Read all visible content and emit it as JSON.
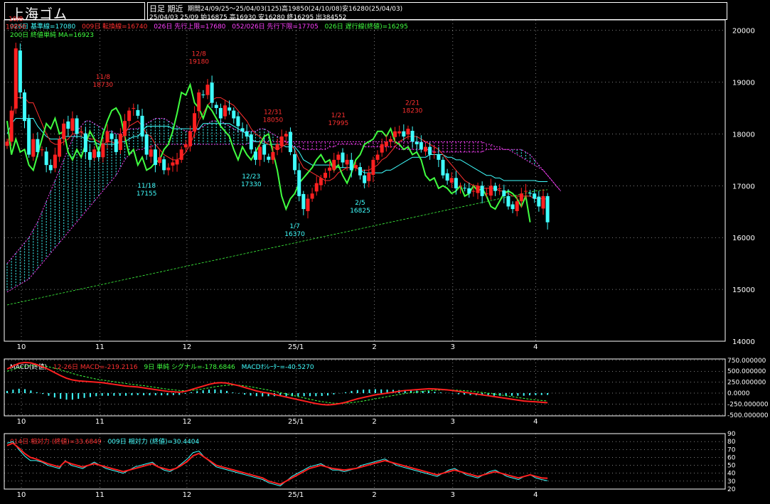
{
  "header": {
    "title": "上海ゴム",
    "mode": "日足 期近",
    "line1_stats": "期間24/09/25〜25/04/03(125)高19850(24/10/08)安16280(25/04/03)",
    "line2_stats": "25/04/03 25/09 始16875 高16930 安16280 終16295 出384552"
  },
  "legend_main": [
    {
      "text": "026日 基準線=17080",
      "color": "#40ffff"
    },
    {
      "text": "009日 転換線=16740",
      "color": "#ff3030"
    },
    {
      "text": "026日 先行上限=17680",
      "color": "#ff40ff"
    },
    {
      "text": "052/026日 先行下限=17705",
      "color": "#ff40ff"
    },
    {
      "text": "026日 遅行線(終値)=16295",
      "color": "#40ff40"
    }
  ],
  "legend_main2": [
    {
      "text": "200日 終値単純 MA=16923",
      "color": "#40ff40"
    }
  ],
  "legend_macd": [
    {
      "text": "MACD(終値)",
      "color": "#ffffff"
    },
    {
      "text": "12-26日 MACD=-219.2116",
      "color": "#ff3030"
    },
    {
      "text": "9日 単純 シグナル=-178.6846",
      "color": "#40ff40"
    },
    {
      "text": "MACDｵｼﾚｰﾀｰ=-40.5270",
      "color": "#40ffff"
    }
  ],
  "legend_rsi": [
    {
      "text": "014日 相対力 (終値)=33.6849",
      "color": "#ff3030"
    },
    {
      "text": "009日 相対力 (終値)=30.4404",
      "color": "#40ffff"
    }
  ],
  "x_labels": [
    "10",
    "11",
    "12",
    "25/1",
    "2",
    "3",
    "4"
  ],
  "colors": {
    "up": "#ff2020",
    "down": "#40ffff",
    "kijun": "#40ffff",
    "tenkan": "#ff3030",
    "senkou": "#ff40ff",
    "cloud_up": "#40ffff",
    "cloud_down": "#ff40ff",
    "chikou": "#40ff40",
    "ma": "#40ff40",
    "annot_hi": "#ff3030",
    "annot_lo": "#40ffff",
    "grid": "#ffffff",
    "macd": "#ff2020",
    "signal": "#40ff40",
    "osc": "#40ffff",
    "rsi14": "#ff2020",
    "rsi9": "#40ffff"
  },
  "chart_data": [
    {
      "type": "candlestick",
      "name": "price",
      "yticks": [
        20000,
        19000,
        18000,
        17000,
        16000,
        15000,
        14000
      ],
      "ylim": [
        14000,
        20200
      ],
      "annotations": [
        {
          "date": "10/8",
          "value": 19850,
          "kind": "high"
        },
        {
          "date": "11/8",
          "value": 18730,
          "kind": "high"
        },
        {
          "date": "11/18",
          "value": 17155,
          "kind": "low"
        },
        {
          "date": "12/8",
          "value": 19180,
          "kind": "high"
        },
        {
          "date": "12/23",
          "value": 17330,
          "kind": "low"
        },
        {
          "date": "12/31",
          "value": 18050,
          "kind": "high"
        },
        {
          "date": "1/7",
          "value": 16370,
          "kind": "low"
        },
        {
          "date": "1/21",
          "value": 17995,
          "kind": "high"
        },
        {
          "date": "2/5",
          "value": 16825,
          "kind": "low"
        },
        {
          "date": "2/21",
          "value": 18230,
          "kind": "high"
        }
      ],
      "close": [
        17850,
        18450,
        19650,
        18800,
        18250,
        17600,
        17900,
        17650,
        17700,
        17400,
        17300,
        17600,
        17900,
        18200,
        18100,
        18300,
        18000,
        18050,
        17650,
        17500,
        17700,
        17550,
        17800,
        18050,
        17900,
        17650,
        18000,
        18250,
        18450,
        18500,
        18350,
        17950,
        17600,
        17700,
        17400,
        17550,
        17300,
        17350,
        17450,
        17500,
        17700,
        17800,
        18050,
        18400,
        18800,
        18750,
        18950,
        18600,
        18500,
        18300,
        18550,
        18450,
        18300,
        18150,
        18050,
        17950,
        17700,
        17500,
        17750,
        17600,
        17500,
        17650,
        17800,
        17950,
        18000,
        17650,
        17300,
        16800,
        16550,
        16750,
        16850,
        17050,
        17150,
        17250,
        17350,
        17500,
        17600,
        17450,
        17500,
        17300,
        17400,
        17200,
        17050,
        17250,
        17500,
        17600,
        17800,
        17850,
        17900,
        18050,
        18050,
        17950,
        18100,
        17850,
        17800,
        17700,
        17750,
        17600,
        17650,
        17500,
        17200,
        17100,
        17150,
        16950,
        17000,
        16950,
        16850,
        16900,
        17000,
        16800,
        16850,
        17000,
        16900,
        16950,
        16800,
        16600,
        16550,
        16700,
        16850,
        16900,
        16850,
        16750,
        16600,
        16800,
        16295
      ],
      "kijun": [
        18000,
        18200,
        18300,
        18300,
        18300,
        18300,
        18300,
        18150,
        18050,
        17950,
        17900,
        17900,
        17900,
        17950,
        17950,
        17950,
        17950,
        17950,
        17900,
        17850,
        17850,
        17800,
        17800,
        17800,
        17800,
        17800,
        17850,
        17850,
        17900,
        17950,
        17950,
        18050,
        18150,
        18150,
        18150,
        18150,
        18150,
        18150,
        18100,
        18100,
        18100,
        18100,
        18100,
        18100,
        18100,
        18200,
        18200,
        18200,
        18200,
        18200,
        18200,
        18200,
        18150,
        18100,
        18050,
        18000,
        17900,
        17850,
        17850,
        17800,
        17800,
        17800,
        17800,
        17800,
        17750,
        17750,
        17750,
        17650,
        17500,
        17450,
        17400,
        17400,
        17400,
        17400,
        17400,
        17400,
        17350,
        17350,
        17350,
        17350,
        17350,
        17300,
        17250,
        17250,
        17250,
        17250,
        17250,
        17300,
        17300,
        17350,
        17400,
        17450,
        17500,
        17550,
        17550,
        17550,
        17550,
        17600,
        17600,
        17600,
        17600,
        17550,
        17550,
        17500,
        17500,
        17450,
        17400,
        17350,
        17300,
        17250,
        17200,
        17200,
        17150,
        17150,
        17100,
        17100,
        17100,
        17100,
        17100,
        17100,
        17100,
        17100,
        17080,
        17080,
        17080
      ],
      "tenkan": [
        17800,
        18100,
        18700,
        18700,
        18700,
        18600,
        18600,
        18400,
        18200,
        18000,
        17850,
        17800,
        17800,
        17850,
        17900,
        18000,
        18000,
        18050,
        17950,
        17900,
        17900,
        17850,
        17800,
        17850,
        17850,
        17800,
        17900,
        18000,
        18150,
        18200,
        18250,
        18150,
        18000,
        17950,
        17800,
        17700,
        17600,
        17550,
        17500,
        17500,
        17550,
        17650,
        17800,
        18000,
        18250,
        18400,
        18550,
        18650,
        18700,
        18700,
        18650,
        18600,
        18550,
        18450,
        18350,
        18250,
        18100,
        18000,
        17950,
        17850,
        17800,
        17750,
        17700,
        17750,
        17800,
        17800,
        17700,
        17500,
        17350,
        17300,
        17250,
        17200,
        17150,
        17100,
        17100,
        17150,
        17250,
        17300,
        17350,
        17350,
        17350,
        17300,
        17300,
        17300,
        17350,
        17400,
        17500,
        17550,
        17650,
        17750,
        17850,
        17900,
        17950,
        17950,
        17950,
        17900,
        17850,
        17800,
        17750,
        17700,
        17600,
        17500,
        17400,
        17300,
        17200,
        17100,
        17050,
        17000,
        17000,
        16950,
        16950,
        16950,
        16950,
        16900,
        16900,
        16850,
        16800,
        16800,
        16800,
        16800,
        16800,
        16750,
        16750,
        16750,
        16740
      ],
      "senkou_a": [
        15500,
        15600,
        15700,
        15800,
        15900,
        16000,
        16150,
        16300,
        16500,
        16700,
        16900,
        17100,
        17300,
        17500,
        17700,
        17900,
        18050,
        18150,
        18250,
        18250,
        18200,
        18150,
        18100,
        18050,
        18050,
        18000,
        18000,
        18050,
        18100,
        18100,
        18100,
        18150,
        18200,
        18250,
        18300,
        18300,
        18300,
        18250,
        18200,
        18150,
        18100,
        18050,
        18050,
        18050,
        18100,
        18150,
        18200,
        18250,
        18250,
        18250,
        18200,
        18150,
        18100,
        18050,
        18050,
        18050,
        18050,
        18050,
        18100,
        18100,
        18050,
        18000,
        17950,
        17900,
        17850,
        17800,
        17750,
        17750,
        17700,
        17700,
        17700,
        17700,
        17700,
        17700,
        17750,
        17750,
        17800,
        17800,
        17800,
        17800,
        17800,
        17800,
        17750,
        17750,
        17750,
        17750,
        17750,
        17750,
        17750,
        17750,
        17700,
        17700,
        17700,
        17700,
        17700,
        17700,
        17700,
        17700,
        17650,
        17650,
        17650,
        17650,
        17650,
        17650,
        17650,
        17650,
        17650,
        17650,
        17650,
        17650,
        17700,
        17700,
        17700,
        17700,
        17700,
        17700,
        17700,
        17700,
        17700,
        17650,
        17600,
        17500,
        17400,
        17300,
        17200,
        17100,
        17000,
        16900
      ],
      "senkou_b": [
        14950,
        15000,
        15050,
        15100,
        15150,
        15200,
        15300,
        15400,
        15500,
        15600,
        15700,
        15800,
        15900,
        16000,
        16100,
        16200,
        16300,
        16400,
        16500,
        16600,
        16700,
        16800,
        16900,
        17000,
        17100,
        17200,
        17350,
        17500,
        17600,
        17650,
        17700,
        17700,
        17750,
        17750,
        17800,
        17800,
        17800,
        17800,
        17800,
        17800,
        17800,
        17800,
        17800,
        17800,
        17800,
        17800,
        17800,
        17800,
        17800,
        17800,
        17800,
        17800,
        17800,
        17800,
        17800,
        17800,
        17850,
        17850,
        17850,
        17850,
        17850,
        17850,
        17850,
        17850,
        17850,
        17850,
        17850,
        17850,
        17850,
        17850,
        17850,
        17850,
        17850,
        17850,
        17850,
        17850,
        17850,
        17850,
        17850,
        17850,
        17850,
        17850,
        17850,
        17850,
        17850,
        17850,
        17850,
        17850,
        17850,
        17850,
        17850,
        17850,
        17850,
        17850,
        17850,
        17850,
        17850,
        17850,
        17850,
        17850,
        17850,
        17850,
        17850,
        17850,
        17850,
        17850,
        17850,
        17850,
        17850,
        17850,
        17800,
        17800,
        17750,
        17750,
        17700,
        17700,
        17650,
        17600,
        17550,
        17500,
        17450,
        17400,
        17350,
        17300,
        17200,
        17100,
        17000,
        16900
      ],
      "ma200": [
        14700,
        14750,
        14800,
        14850,
        14900,
        14950,
        15000,
        15050,
        15100,
        15150,
        15200,
        15250,
        15300,
        15350,
        15400,
        15450,
        15500,
        15550,
        15600,
        15650,
        15700,
        15750,
        15800,
        15850,
        15900,
        15950,
        16000,
        16050,
        16100,
        16150,
        16200,
        16250,
        16300,
        16350,
        16400,
        16450,
        16500,
        16550,
        16600,
        16650,
        16700,
        16750,
        16800,
        16850,
        16900,
        16923
      ]
    },
    {
      "type": "macd",
      "yticks": [
        750,
        500,
        250,
        0,
        -250,
        -500
      ],
      "ytick_labels": [
        "750.000000",
        "500.000000",
        "250.000000",
        "0.0000",
        "-250.000000",
        "-500.000000"
      ],
      "ylim": [
        -520,
        780
      ],
      "macd": [
        550,
        620,
        680,
        700,
        690,
        650,
        600,
        540,
        470,
        400,
        340,
        300,
        280,
        270,
        260,
        250,
        240,
        220,
        200,
        180,
        160,
        150,
        140,
        120,
        100,
        80,
        60,
        40,
        30,
        20,
        40,
        80,
        120,
        160,
        200,
        230,
        240,
        230,
        200,
        170,
        130,
        90,
        50,
        20,
        0,
        -30,
        -60,
        -90,
        -120,
        -150,
        -180,
        -210,
        -240,
        -260,
        -270,
        -260,
        -240,
        -210,
        -170,
        -130,
        -100,
        -70,
        -40,
        -20,
        0,
        20,
        40,
        60,
        70,
        80,
        90,
        100,
        95,
        85,
        75,
        60,
        40,
        20,
        0,
        -20,
        -40,
        -60,
        -80,
        -100,
        -120,
        -140,
        -160,
        -180,
        -190,
        -200,
        -210,
        -219
      ],
      "signal": [
        500,
        540,
        580,
        610,
        630,
        630,
        620,
        600,
        570,
        530,
        490,
        450,
        410,
        380,
        350,
        320,
        300,
        280,
        260,
        240,
        220,
        200,
        185,
        170,
        150,
        130,
        110,
        90,
        75,
        60,
        55,
        60,
        75,
        95,
        120,
        145,
        165,
        180,
        185,
        180,
        165,
        145,
        120,
        95,
        70,
        40,
        10,
        -20,
        -50,
        -80,
        -110,
        -140,
        -170,
        -195,
        -215,
        -230,
        -235,
        -230,
        -220,
        -200,
        -180,
        -155,
        -130,
        -105,
        -80,
        -55,
        -30,
        -10,
        10,
        25,
        40,
        55,
        65,
        70,
        72,
        70,
        65,
        55,
        45,
        30,
        15,
        0,
        -20,
        -40,
        -60,
        -80,
        -100,
        -120,
        -140,
        -155,
        -168,
        -179
      ]
    },
    {
      "type": "line",
      "name": "rsi",
      "yticks": [
        90,
        80,
        70,
        60,
        50,
        40,
        30,
        20
      ],
      "ylim": [
        20,
        90
      ],
      "rsi14": [
        75,
        78,
        72,
        65,
        60,
        58,
        55,
        52,
        50,
        48,
        55,
        52,
        50,
        48,
        50,
        52,
        50,
        48,
        46,
        44,
        42,
        44,
        46,
        48,
        50,
        52,
        48,
        46,
        44,
        46,
        50,
        55,
        62,
        65,
        60,
        55,
        50,
        48,
        46,
        44,
        42,
        40,
        38,
        36,
        34,
        30,
        28,
        26,
        30,
        34,
        38,
        42,
        46,
        48,
        50,
        48,
        46,
        45,
        44,
        45,
        46,
        48,
        50,
        52,
        54,
        56,
        54,
        52,
        50,
        48,
        46,
        44,
        42,
        40,
        38,
        40,
        42,
        44,
        42,
        40,
        38,
        36,
        38,
        40,
        42,
        40,
        38,
        36,
        34,
        36,
        38,
        36,
        34,
        33.7
      ],
      "rsi9": [
        78,
        80,
        70,
        62,
        56,
        56,
        54,
        50,
        48,
        46,
        56,
        50,
        48,
        46,
        50,
        54,
        50,
        46,
        44,
        42,
        40,
        44,
        48,
        50,
        52,
        54,
        48,
        44,
        42,
        46,
        52,
        58,
        66,
        68,
        60,
        54,
        48,
        46,
        44,
        42,
        40,
        38,
        36,
        34,
        32,
        28,
        26,
        24,
        30,
        36,
        40,
        44,
        48,
        50,
        52,
        48,
        44,
        44,
        42,
        44,
        46,
        50,
        52,
        54,
        56,
        58,
        54,
        50,
        48,
        46,
        44,
        42,
        40,
        38,
        36,
        40,
        44,
        46,
        42,
        38,
        36,
        34,
        38,
        42,
        44,
        40,
        36,
        34,
        32,
        36,
        38,
        34,
        32,
        30.4
      ]
    }
  ]
}
